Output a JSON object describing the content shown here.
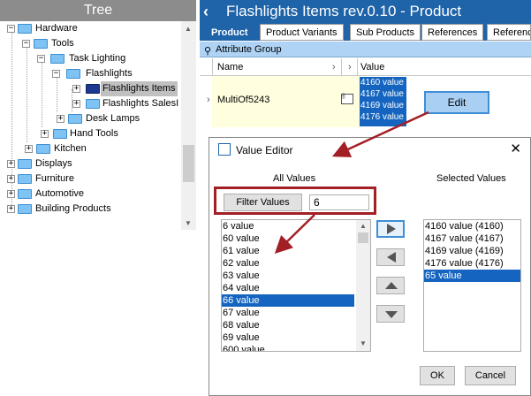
{
  "tree": {
    "header": "Tree",
    "nodes": [
      {
        "label": "Hardware",
        "expander": "−"
      },
      {
        "label": "Tools",
        "expander": "−"
      },
      {
        "label": "Task Lighting",
        "expander": "−"
      },
      {
        "label": "Flashlights",
        "expander": "−"
      },
      {
        "label": "Flashlights Items",
        "expander": "+"
      },
      {
        "label": "Flashlights SalesI",
        "expander": "+"
      },
      {
        "label": "Desk Lamps",
        "expander": "+"
      },
      {
        "label": "Hand Tools",
        "expander": "+"
      },
      {
        "label": "Kitchen",
        "expander": "+"
      },
      {
        "label": "Displays",
        "expander": "+"
      },
      {
        "label": "Furniture",
        "expander": "+"
      },
      {
        "label": "Automotive",
        "expander": "+"
      },
      {
        "label": "Building Products",
        "expander": "+"
      }
    ]
  },
  "header": {
    "back_icon": "‹",
    "title": "Flashlights Items rev.0.10 - Product"
  },
  "tabs": [
    "Product",
    "Product Variants",
    "Sub Products",
    "References",
    "Referenc"
  ],
  "attribute_group": {
    "label": "Attribute Group",
    "pin_icon": "⚲"
  },
  "grid": {
    "col_name": "Name",
    "col_value": "Value",
    "sort_glyph": "›",
    "row_expander": "›",
    "row_name": "MultiOf5243",
    "row_values": [
      "4160 value",
      "4167 value",
      "4169 value",
      "4176 value"
    ],
    "edit_label": "Edit"
  },
  "dialog": {
    "title": "Value Editor",
    "close": "✕",
    "all_values_label": "All Values",
    "selected_values_label": "Selected Values",
    "filter_button": "Filter Values",
    "filter_value": "6",
    "all_values": [
      "6 value",
      "60 value",
      "61 value",
      "62 value",
      "63 value",
      "64 value",
      "66 value",
      "67 value",
      "68 value",
      "69 value",
      "600 value"
    ],
    "all_values_selected_index": 6,
    "selected_values": [
      "4160 value (4160)",
      "4167 value (4167)",
      "4169 value (4169)",
      "4176 value (4176)",
      "65 value"
    ],
    "selected_values_selected_index": 4,
    "ok": "OK",
    "cancel": "Cancel"
  },
  "colors": {
    "accent": "#1f63a8",
    "selection": "#1565c0",
    "annotation": "#a31f26"
  }
}
